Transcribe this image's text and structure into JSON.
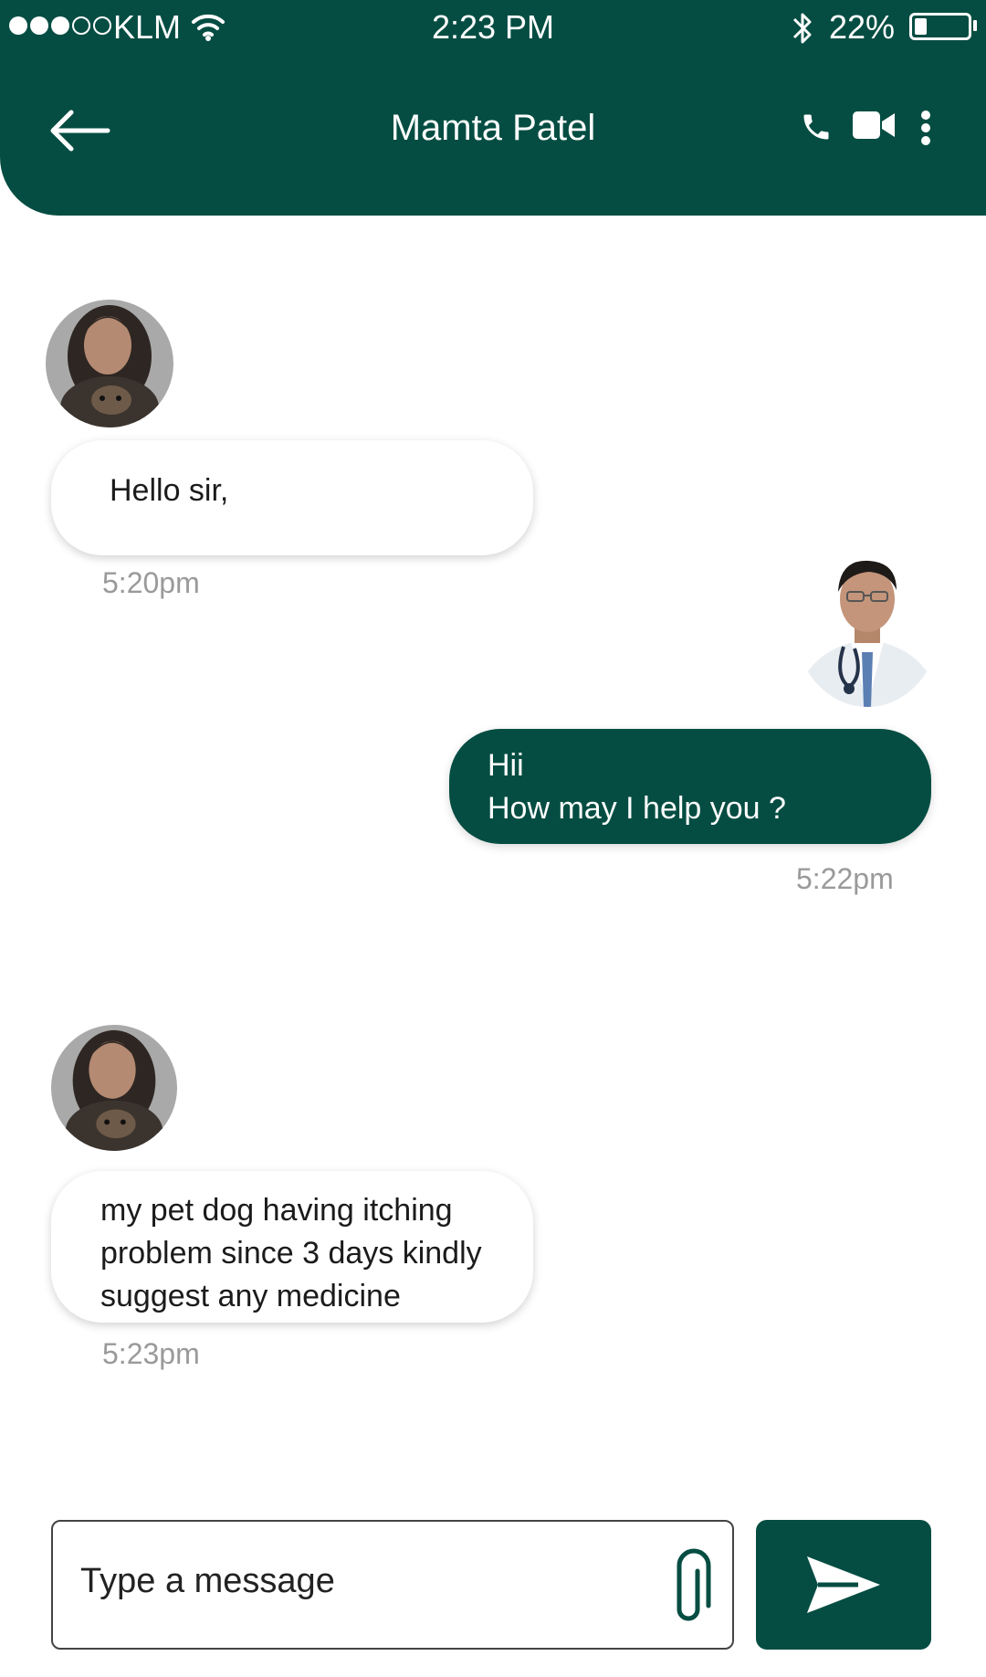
{
  "status_bar": {
    "carrier": "KLM",
    "time": "2:23 PM",
    "battery": "22%",
    "battery_level": 0.22,
    "signal_bars": 3,
    "signal_total": 5
  },
  "header": {
    "title": "Mamta Patel",
    "icons": [
      "back-arrow-icon",
      "phone-icon",
      "video-call-icon",
      "more-vertical-icon"
    ],
    "background": "#054d42"
  },
  "messages": [
    {
      "sender": "contact",
      "lines": [
        "Hello sir,"
      ],
      "time": "5:20pm"
    },
    {
      "sender": "doctor",
      "lines": [
        "Hii",
        "How may I help you ?"
      ],
      "time": "5:22pm"
    },
    {
      "sender": "contact",
      "lines": [
        "my pet dog having itching",
        "problem since 3 days kindly",
        "suggest any medicine"
      ],
      "time": "5:23pm"
    }
  ],
  "composer": {
    "placeholder": "Type a message",
    "icons": [
      "paperclip-icon",
      "send-icon"
    ]
  },
  "colors": {
    "accent": "#054d42",
    "timestamp": "#9a9a9a",
    "bubble_in": "#ffffff",
    "bubble_out": "#054d42"
  }
}
